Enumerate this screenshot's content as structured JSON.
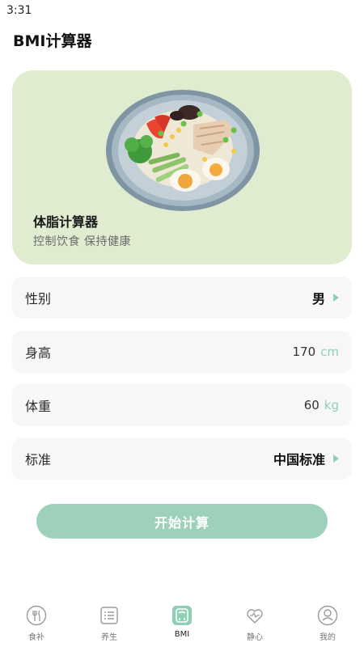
{
  "status_bar": {
    "time": "3:31"
  },
  "header": {
    "title": "BMI计算器"
  },
  "hero": {
    "title": "体脂计算器",
    "subtitle": "控制饮食 保持健康"
  },
  "form": {
    "gender": {
      "label": "性别",
      "value": "男"
    },
    "height": {
      "label": "身高",
      "value": "170",
      "unit": "cm"
    },
    "weight": {
      "label": "体重",
      "value": "60",
      "unit": "kg"
    },
    "standard": {
      "label": "标准",
      "value": "中国标准"
    }
  },
  "action": {
    "start_label": "开始计算"
  },
  "tab_bar": {
    "active": "BMI",
    "items": [
      {
        "label": "食补",
        "icon": "food-icon"
      },
      {
        "label": "养生",
        "icon": "list-icon"
      },
      {
        "label": "BMI",
        "icon": "scale-icon"
      },
      {
        "label": "静心",
        "icon": "heart-icon"
      },
      {
        "label": "我的",
        "icon": "profile-icon"
      }
    ]
  },
  "colors": {
    "accent": "#9ed1bb",
    "accent_text": "#8fcfb6",
    "hero_bg": "#dfecd0",
    "row_bg": "#f7f7f7"
  }
}
